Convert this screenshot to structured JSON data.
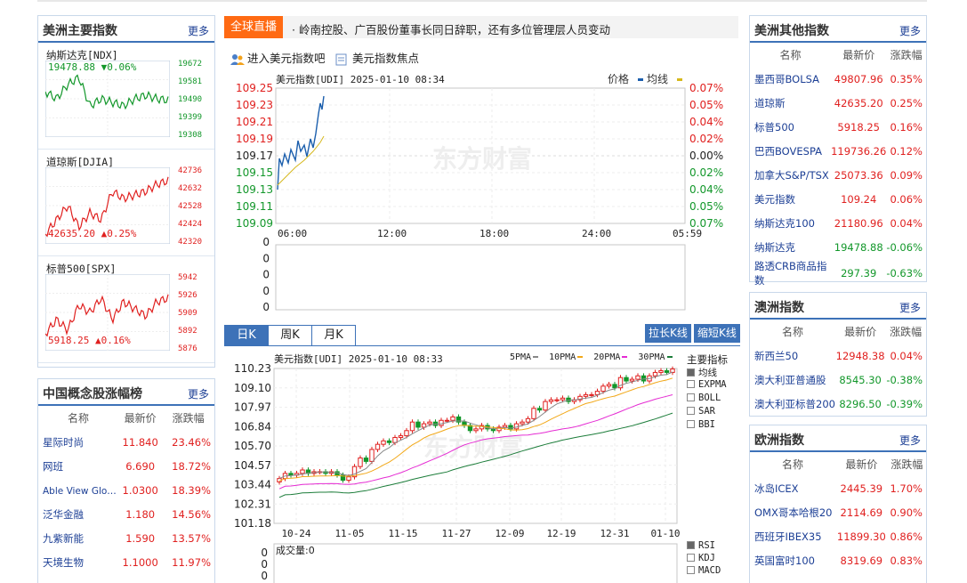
{
  "left": {
    "americas_main": {
      "title": "美洲主要指数",
      "more": "更多",
      "charts": [
        {
          "name": "纳斯达克[NDX]",
          "value": "19478.88",
          "change": "▼0.06%",
          "dir": "down",
          "ticks": [
            "19672",
            "19581",
            "19490",
            "19399",
            "19308"
          ],
          "color": "#12972a"
        },
        {
          "name": "道琼斯[DJIA]",
          "value": "42635.20",
          "change": "▲0.25%",
          "dir": "up",
          "ticks": [
            "42736",
            "42632",
            "42528",
            "42424",
            "42320"
          ],
          "color": "#e0201f"
        },
        {
          "name": "标普500[SPX]",
          "value": "5918.25",
          "change": "▲0.16%",
          "dir": "up",
          "ticks": [
            "5942",
            "5926",
            "5909",
            "5892",
            "5876"
          ],
          "color": "#e0201f"
        }
      ]
    },
    "china_concept": {
      "title": "中国概念股涨幅榜",
      "more": "更多",
      "headers": [
        "名称",
        "最新价",
        "涨跌幅"
      ],
      "rows": [
        {
          "name": "星际时尚",
          "price": "11.840",
          "pct": "23.46%"
        },
        {
          "name": "网班",
          "price": "6.690",
          "pct": "18.72%"
        },
        {
          "name": "Able View Glo…",
          "price": "1.0300",
          "pct": "18.39%"
        },
        {
          "name": "泛华金融",
          "price": "1.180",
          "pct": "14.56%"
        },
        {
          "name": "九紫新能",
          "price": "1.590",
          "pct": "13.57%"
        },
        {
          "name": "天境生物",
          "price": "1.1000",
          "pct": "11.97%"
        }
      ]
    }
  },
  "center": {
    "news_tag": "全球直播",
    "news_text": "· 岭南控股、广百股份董事长同日辞职，还有多位管理层人员变动",
    "link_forum": "进入美元指数吧",
    "link_focus": "美元指数焦点",
    "intraday": {
      "title": "美元指数[UDI] 2025-01-10 08:34",
      "legend_price": "价格",
      "legend_avg": "均线",
      "y_ticks": [
        "109.25",
        "109.23",
        "109.21",
        "109.19",
        "109.17",
        "109.15",
        "109.13",
        "109.11",
        "109.09"
      ],
      "pct_ticks": [
        "0.07%",
        "0.05%",
        "0.04%",
        "0.02%",
        "0.00%",
        "0.02%",
        "0.04%",
        "0.05%",
        "0.07%"
      ],
      "x_ticks": [
        "06:00",
        "12:00",
        "18:00",
        "24:00",
        "05:59"
      ],
      "vol_ticks": [
        "0",
        "0",
        "0",
        "0",
        "0"
      ],
      "watermark": "东方财富"
    },
    "tabs": [
      "日K",
      "周K",
      "月K"
    ],
    "btn_long": "拉长K线",
    "btn_short": "缩短K线",
    "kline": {
      "title": "美元指数[UDI] 2025-01-10 08:33",
      "ma_labels": [
        "5PMA",
        "10PMA",
        "20PMA",
        "30PMA"
      ],
      "y_ticks": [
        "110.23",
        "109.10",
        "107.97",
        "106.84",
        "105.70",
        "104.57",
        "103.44",
        "102.31",
        "101.18"
      ],
      "x_ticks": [
        "10-24",
        "11-05",
        "11-15",
        "11-27",
        "12-09",
        "12-19",
        "12-31",
        "01-10"
      ],
      "vol_title": "成交量:0",
      "vol_ticks": [
        "0",
        "0",
        "0"
      ],
      "indicator_title": "主要指标",
      "indicators": [
        "均线",
        "EXPMA",
        "BOLL",
        "SAR",
        "BBI"
      ],
      "sub_indicators": [
        "RSI",
        "KDJ",
        "MACD"
      ]
    }
  },
  "right": {
    "americas_other": {
      "title": "美洲其他指数",
      "more": "更多",
      "headers": [
        "名称",
        "最新价",
        "涨跌幅"
      ],
      "rows": [
        {
          "name": "墨西哥BOLSA",
          "price": "49807.96",
          "pct": "0.35%",
          "dir": "up"
        },
        {
          "name": "道琼斯",
          "price": "42635.20",
          "pct": "0.25%",
          "dir": "up"
        },
        {
          "name": "标普500",
          "price": "5918.25",
          "pct": "0.16%",
          "dir": "up"
        },
        {
          "name": "巴西BOVESPA",
          "price": "119736.26",
          "pct": "0.12%",
          "dir": "up"
        },
        {
          "name": "加拿大S&P/TSX",
          "price": "25073.36",
          "pct": "0.09%",
          "dir": "up"
        },
        {
          "name": "美元指数",
          "price": "109.24",
          "pct": "0.06%",
          "dir": "up"
        },
        {
          "name": "纳斯达克100",
          "price": "21180.96",
          "pct": "0.04%",
          "dir": "up"
        },
        {
          "name": "纳斯达克",
          "price": "19478.88",
          "pct": "-0.06%",
          "dir": "down"
        },
        {
          "name": "路透CRB商品指数",
          "price": "297.39",
          "pct": "-0.63%",
          "dir": "down"
        }
      ]
    },
    "australia": {
      "title": "澳洲指数",
      "more": "更多",
      "headers": [
        "名称",
        "最新价",
        "涨跌幅"
      ],
      "rows": [
        {
          "name": "新西兰50",
          "price": "12948.38",
          "pct": "0.04%",
          "dir": "up"
        },
        {
          "name": "澳大利亚普通股",
          "price": "8545.30",
          "pct": "-0.38%",
          "dir": "down"
        },
        {
          "name": "澳大利亚标普200",
          "price": "8296.50",
          "pct": "-0.39%",
          "dir": "down"
        }
      ]
    },
    "europe": {
      "title": "欧洲指数",
      "more": "更多",
      "headers": [
        "名称",
        "最新价",
        "涨跌幅"
      ],
      "rows": [
        {
          "name": "冰岛ICEX",
          "price": "2445.39",
          "pct": "1.70%",
          "dir": "up"
        },
        {
          "name": "OMX哥本哈根20",
          "price": "2114.69",
          "pct": "0.90%",
          "dir": "up"
        },
        {
          "name": "西班牙IBEX35",
          "price": "11899.30",
          "pct": "0.86%",
          "dir": "up"
        },
        {
          "name": "英国富时100",
          "price": "8319.69",
          "pct": "0.83%",
          "dir": "up"
        }
      ]
    }
  },
  "colors": {
    "up": "#e0201f",
    "down": "#12972a",
    "accent": "#3d72b8",
    "news": "#ff6a13"
  }
}
